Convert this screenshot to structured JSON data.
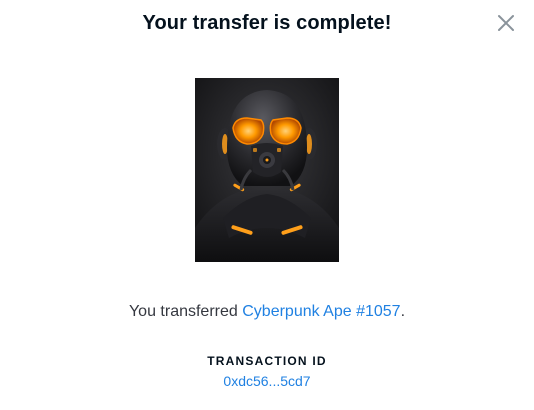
{
  "modal": {
    "title": "Your transfer is complete!",
    "close_icon": "close-icon"
  },
  "message": {
    "prefix": "You transferred ",
    "item_name": "Cyberpunk Ape #1057",
    "suffix": "."
  },
  "transaction": {
    "label": "TRANSACTION ID",
    "id": "0xdc56...5cd7"
  },
  "colors": {
    "link": "#2081e2",
    "title": "#04111d",
    "body_text": "#353840",
    "close_icon": "#8a939b",
    "nft_glow": "#ffa500"
  }
}
